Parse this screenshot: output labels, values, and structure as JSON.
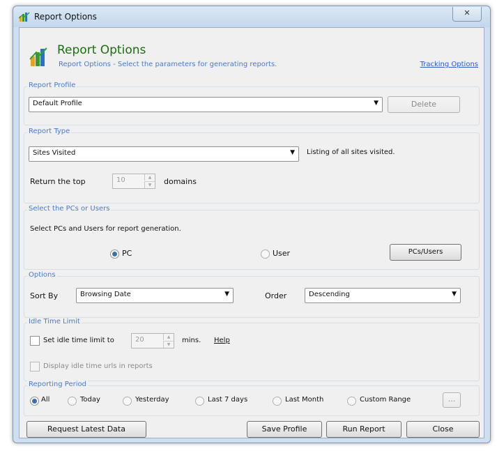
{
  "window": {
    "title": "Report Options",
    "close_glyph": "✕"
  },
  "header": {
    "title": "Report Options",
    "subtitle": "Report Options - Select the parameters for generating reports.",
    "tracking_link": "Tracking Options"
  },
  "report_profile": {
    "label": "Report Profile",
    "selected": "Default Profile",
    "delete_label": "Delete"
  },
  "report_type": {
    "label": "Report Type",
    "selected": "Sites Visited",
    "description": "Listing of all sites visited.",
    "return_top_label": "Return the top",
    "return_top_value": "10",
    "domains_label": "domains"
  },
  "select_pcs": {
    "label": "Select the PCs or Users",
    "instruction": "Select PCs and Users for report generation.",
    "pc_label": "PC",
    "user_label": "User",
    "pcs_users_button": "PCs/Users",
    "selected": "PC"
  },
  "options": {
    "label": "Options",
    "sort_by_label": "Sort By",
    "sort_by_value": "Browsing Date",
    "order_label": "Order",
    "order_value": "Descending"
  },
  "idle": {
    "label": "Idle Time Limit",
    "set_idle_label": "Set idle time limit to",
    "idle_value": "20",
    "mins_label": "mins.",
    "help_link": "Help",
    "display_idle_label": "Display idle time urls in reports",
    "set_idle_checked": false,
    "display_idle_checked": false
  },
  "period": {
    "label": "Reporting Period",
    "options": [
      "All",
      "Today",
      "Yesterday",
      "Last 7 days",
      "Last Month",
      "Custom Range"
    ],
    "selected": "All",
    "browse_label": "..."
  },
  "footer": {
    "request_label": "Request Latest Data",
    "save_label": "Save Profile",
    "run_label": "Run Report",
    "close_label": "Close"
  },
  "colors": {
    "accent_green": "#1d6d12",
    "link_blue": "#2a5bd0",
    "group_label_blue": "#4b7bc8"
  },
  "icons": [
    "app-chart-icon",
    "report-logo-icon",
    "dropdown-arrow-icon",
    "spinner-icon"
  ]
}
